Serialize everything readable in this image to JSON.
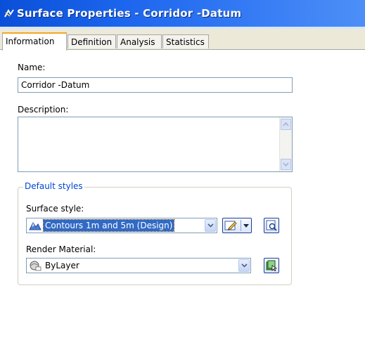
{
  "window": {
    "title": "Surface Properties - Corridor -Datum",
    "icon": "surface-app-icon"
  },
  "tabs": [
    {
      "label": "Information",
      "active": true
    },
    {
      "label": "Definition",
      "active": false
    },
    {
      "label": "Analysis",
      "active": false
    },
    {
      "label": "Statistics",
      "active": false
    }
  ],
  "form": {
    "name_label": "Name:",
    "name_value": "Corridor -Datum",
    "description_label": "Description:",
    "description_value": ""
  },
  "default_styles": {
    "group_label": "Default styles",
    "surface_style_label": "Surface style:",
    "surface_style_value": "Contours 1m and 5m (Design)",
    "render_material_label": "Render Material:",
    "render_material_value": "ByLayer"
  },
  "colors": {
    "title_bar": "#1d66ee",
    "selection": "#316ac5",
    "group_label": "#0046d5",
    "active_tab_accent": "#f5a623"
  }
}
